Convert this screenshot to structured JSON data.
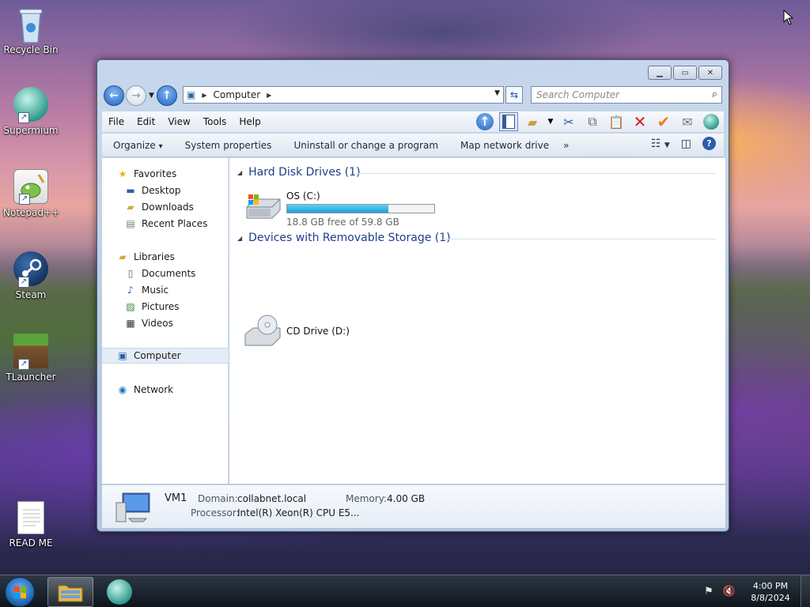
{
  "desktop": {
    "icons": [
      {
        "label": "Recycle Bin",
        "icon": "recycle-bin-icon"
      },
      {
        "label": "Supermium",
        "icon": "supermium-icon"
      },
      {
        "label": "Notepad++",
        "icon": "notepadpp-icon"
      },
      {
        "label": "Steam",
        "icon": "steam-icon"
      },
      {
        "label": "TLauncher",
        "icon": "tlauncher-icon"
      },
      {
        "label": "READ ME",
        "icon": "text-file-icon"
      }
    ]
  },
  "window": {
    "address": {
      "crumb": "Computer"
    },
    "search_placeholder": "Search Computer",
    "menu": [
      "File",
      "Edit",
      "View",
      "Tools",
      "Help"
    ],
    "commands": [
      "Organize",
      "System properties",
      "Uninstall or change a program",
      "Map network drive"
    ],
    "organize_arrow": "▾",
    "more_commands": "»",
    "nav": {
      "favorites": "Favorites",
      "desktop": "Desktop",
      "downloads": "Downloads",
      "recent_places": "Recent Places",
      "libraries": "Libraries",
      "documents": "Documents",
      "music": "Music",
      "pictures": "Pictures",
      "videos": "Videos",
      "computer": "Computer",
      "network": "Network"
    },
    "groups": {
      "hdd": "Hard Disk Drives (1)",
      "removable": "Devices with Removable Storage (1)"
    },
    "drives": {
      "c_name": "OS (C:)",
      "c_free": "18.8 GB free of 59.8 GB",
      "c_used_fraction": 0.686,
      "d_name": "CD Drive (D:)"
    },
    "details": {
      "computer_name": "VM1",
      "domain_label": "Domain:",
      "domain_value": "collabnet.local",
      "memory_label": "Memory:",
      "memory_value": "4.00 GB",
      "processor_label": "Processor:",
      "processor_value": "Intel(R) Xeon(R) CPU E5..."
    }
  },
  "taskbar": {
    "time": "4:00 PM",
    "date": "8/8/2024"
  },
  "colors": {
    "accent": "#1e3e8a",
    "drive_fill": "#1e9ed8"
  }
}
